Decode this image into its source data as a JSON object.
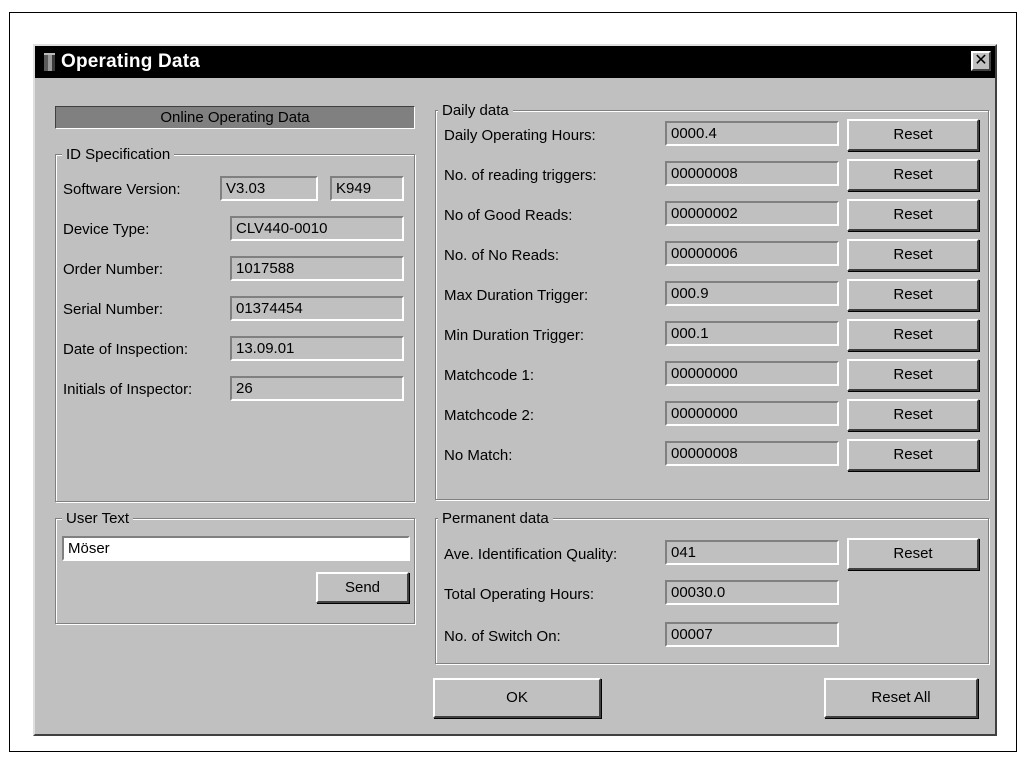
{
  "window": {
    "title": "Operating Data",
    "close_label": "✕"
  },
  "header": {
    "online_operating_data": "Online Operating Data"
  },
  "id_spec": {
    "legend": "ID Specification",
    "software_version_label": "Software Version:",
    "software_version_value": "V3.03",
    "software_version_code": "K949",
    "device_type_label": "Device Type:",
    "device_type_value": "CLV440-0010",
    "order_number_label": "Order Number:",
    "order_number_value": "1017588",
    "serial_number_label": "Serial Number:",
    "serial_number_value": "01374454",
    "date_of_inspection_label": "Date of Inspection:",
    "date_of_inspection_value": "13.09.01",
    "initials_of_inspector_label": "Initials of Inspector:",
    "initials_of_inspector_value": "26"
  },
  "user_text": {
    "legend": "User Text",
    "value": "Möser",
    "send_label": "Send"
  },
  "daily": {
    "legend": "Daily data",
    "rows": [
      {
        "label": "Daily Operating Hours:",
        "value": "0000.4",
        "button": "Reset"
      },
      {
        "label": "No. of reading triggers:",
        "value": "00000008",
        "button": "Reset"
      },
      {
        "label": "No of Good Reads:",
        "value": "00000002",
        "button": "Reset"
      },
      {
        "label": "No. of No Reads:",
        "value": "00000006",
        "button": "Reset"
      },
      {
        "label": "Max Duration Trigger:",
        "value": "000.9",
        "button": "Reset"
      },
      {
        "label": "Min Duration Trigger:",
        "value": "000.1",
        "button": "Reset"
      },
      {
        "label": "Matchcode 1:",
        "value": "00000000",
        "button": "Reset"
      },
      {
        "label": "Matchcode 2:",
        "value": "00000000",
        "button": "Reset"
      },
      {
        "label": "No Match:",
        "value": "00000008",
        "button": "Reset"
      }
    ]
  },
  "permanent": {
    "legend": "Permanent data",
    "ave_identification_quality_label": "Ave. Identification Quality:",
    "ave_identification_quality_value": "041",
    "ave_identification_quality_button": "Reset",
    "total_operating_hours_label": "Total Operating Hours:",
    "total_operating_hours_value": "00030.0",
    "no_of_switch_on_label": "No. of Switch On:",
    "no_of_switch_on_value": "00007"
  },
  "footer": {
    "ok_label": "OK",
    "reset_all_label": "Reset All"
  }
}
